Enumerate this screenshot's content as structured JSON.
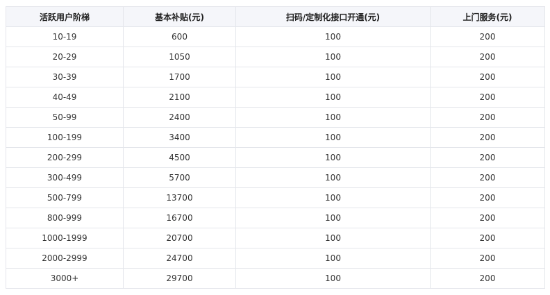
{
  "table": {
    "headers": [
      "活跃用户阶梯",
      "基本补贴(元)",
      "扫码/定制化接口开通(元)",
      "上门服务(元)"
    ],
    "rows": [
      [
        "10-19",
        "600",
        "100",
        "200"
      ],
      [
        "20-29",
        "1050",
        "100",
        "200"
      ],
      [
        "30-39",
        "1700",
        "100",
        "200"
      ],
      [
        "40-49",
        "2100",
        "100",
        "200"
      ],
      [
        "50-99",
        "2400",
        "100",
        "200"
      ],
      [
        "100-199",
        "3400",
        "100",
        "200"
      ],
      [
        "200-299",
        "4500",
        "100",
        "200"
      ],
      [
        "300-499",
        "5700",
        "100",
        "200"
      ],
      [
        "500-799",
        "13700",
        "100",
        "200"
      ],
      [
        "800-999",
        "16700",
        "100",
        "200"
      ],
      [
        "1000-1999",
        "20700",
        "100",
        "200"
      ],
      [
        "2000-2999",
        "24700",
        "100",
        "200"
      ],
      [
        "3000+",
        "29700",
        "100",
        "200"
      ]
    ]
  },
  "colors": {
    "header_background": "#f5f6fa",
    "border": "#e4e6eb",
    "text": "#333333"
  }
}
